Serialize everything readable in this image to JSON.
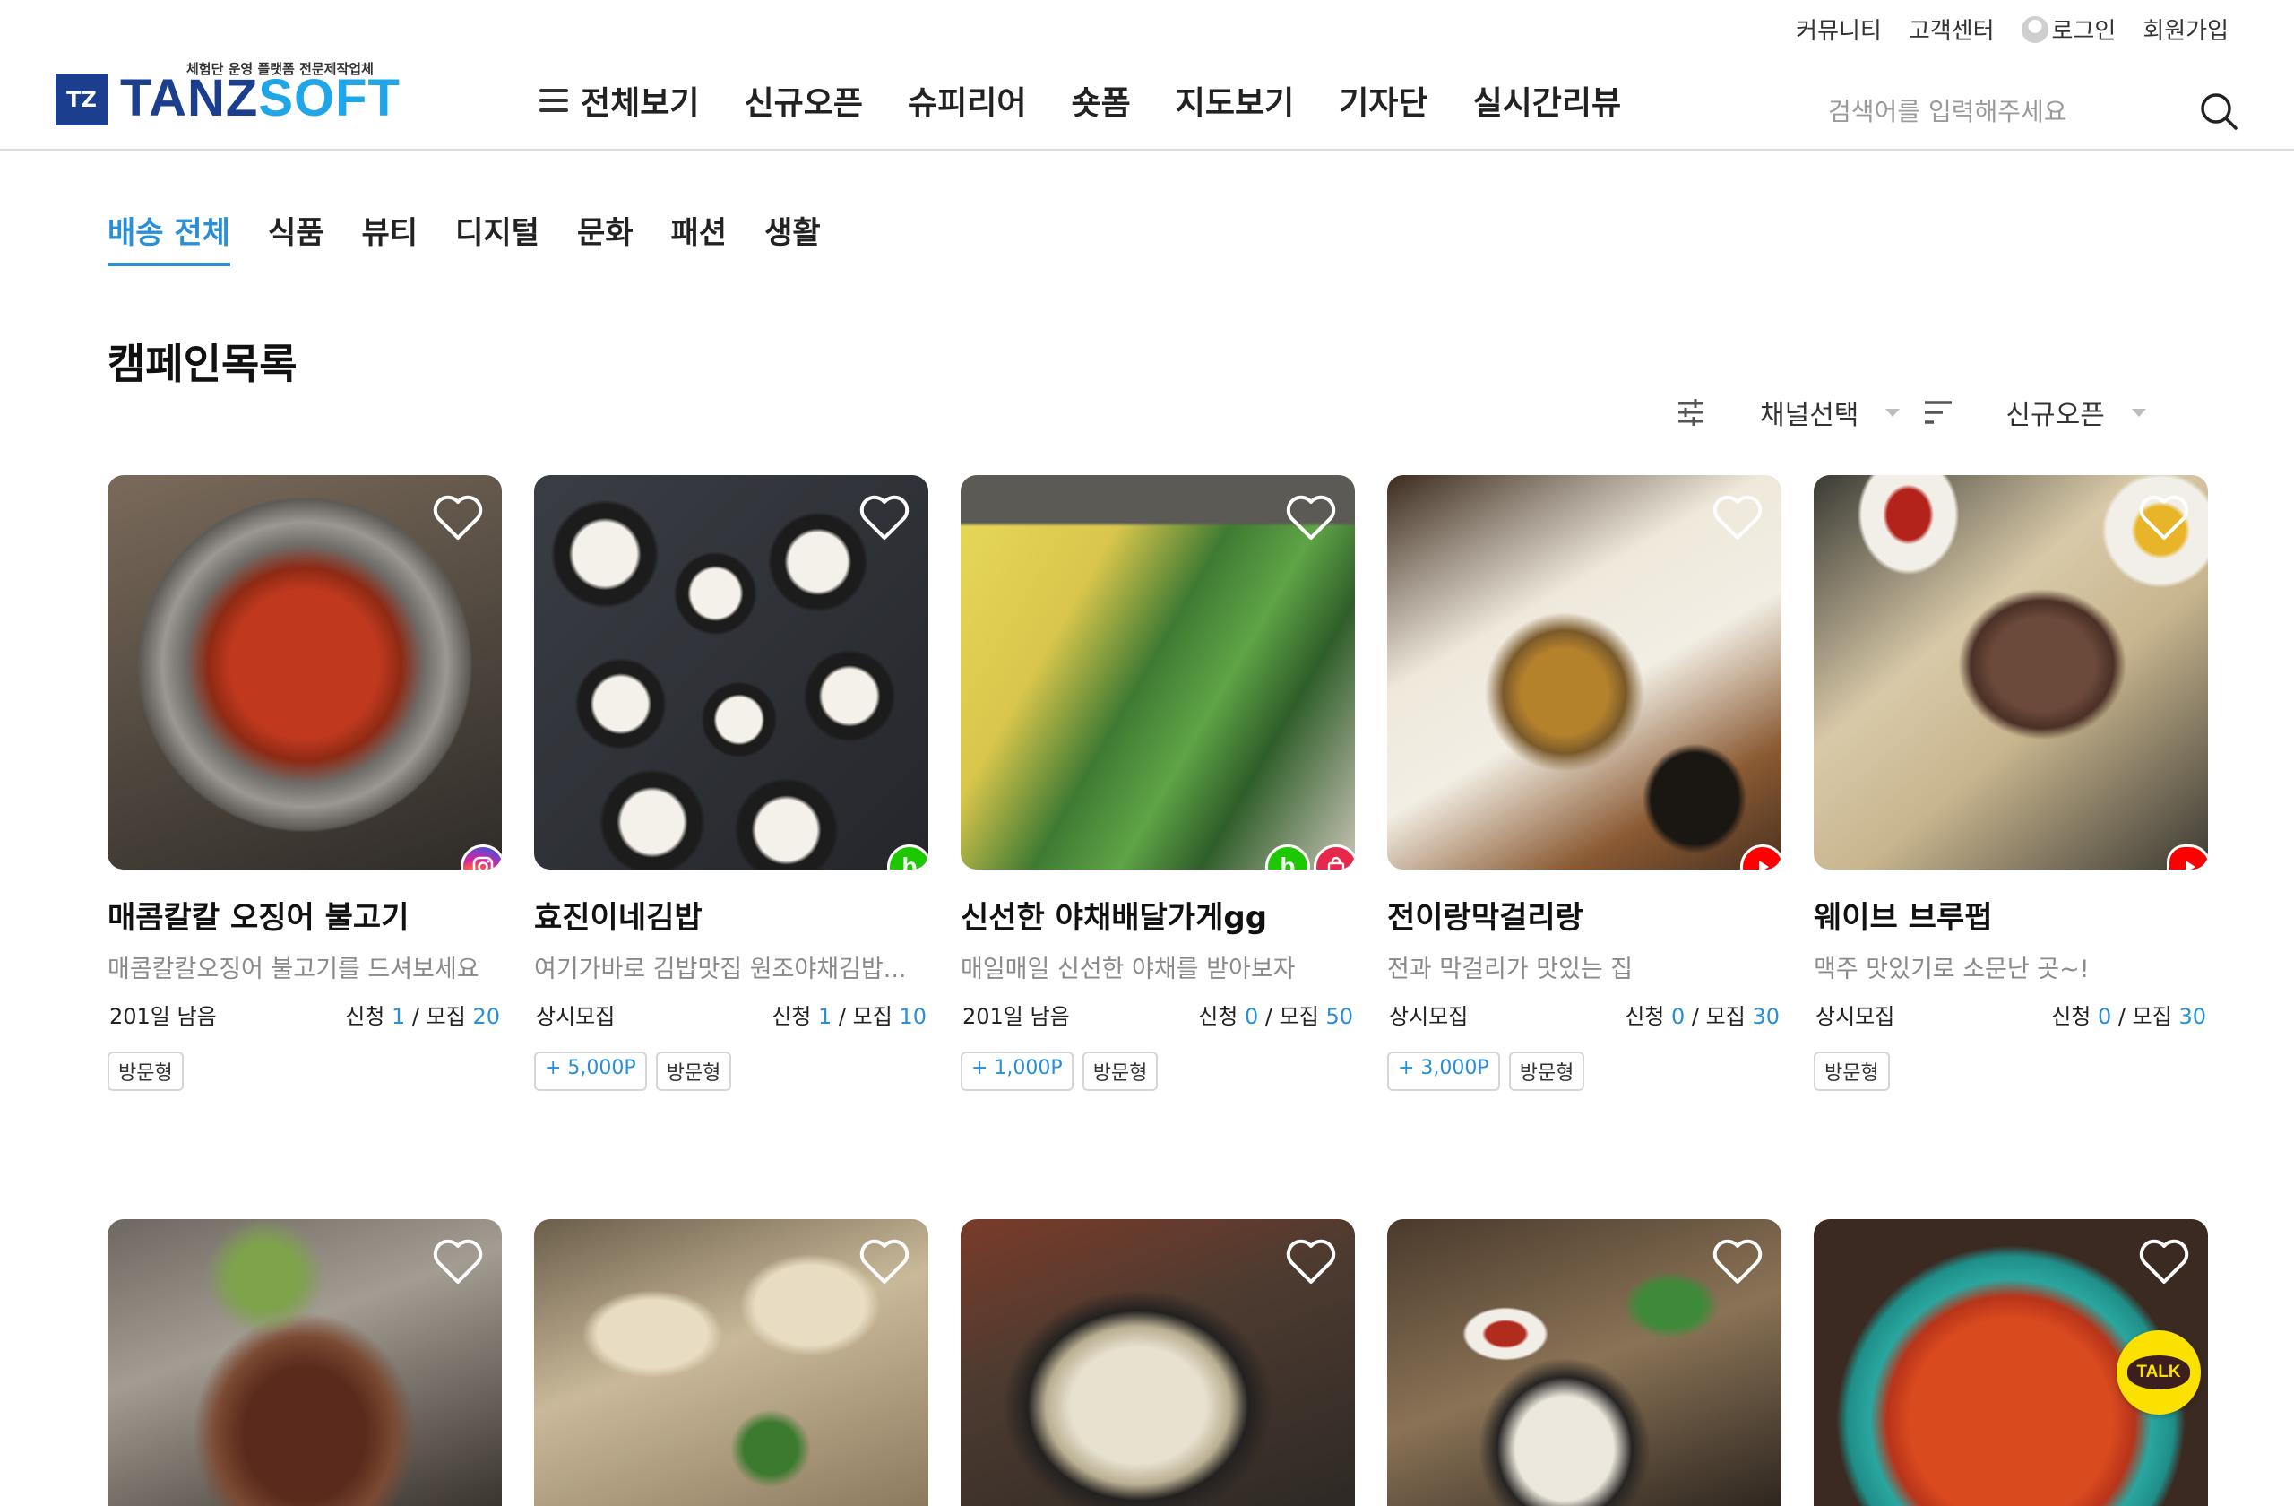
{
  "util_links": {
    "community": "커뮤니티",
    "customer_center": "고객센터",
    "login": "로그인",
    "signup": "회원가입"
  },
  "logo": {
    "tagline": "체험단 운영 플랫폼 전문제작업체",
    "mark": "TZ",
    "brand_main": "TANZ",
    "brand_accent": "SOFT"
  },
  "nav": {
    "items": [
      "전체보기",
      "신규오픈",
      "슈피리어",
      "숏폼",
      "지도보기",
      "기자단",
      "실시간리뷰"
    ]
  },
  "search": {
    "placeholder": "검색어를 입력해주세요"
  },
  "category_tabs": [
    "배송 전체",
    "식품",
    "뷰티",
    "디지털",
    "문화",
    "패션",
    "생활"
  ],
  "page_title": "캠페인목록",
  "filters": {
    "channel": "채널선택",
    "sort": "신규오픈"
  },
  "labels": {
    "apply": "신청",
    "recruit": "모집"
  },
  "campaigns": [
    {
      "name": "매콤칼칼 오징어 불고기",
      "desc": "매콤칼칼오징어 불고기를 드셔보세요",
      "status": "201일 남음",
      "applied": "1",
      "recruit": "20",
      "tags": [
        "방문형"
      ],
      "point": "",
      "channels": [
        "instagram"
      ]
    },
    {
      "name": "효진이네김밥",
      "desc": "여기가바로 김밥맛집 원조야채김밥...",
      "status": "상시모집",
      "applied": "1",
      "recruit": "10",
      "tags": [
        "방문형"
      ],
      "point": "+ 5,000P",
      "channels": [
        "blog"
      ]
    },
    {
      "name": "신선한 야채배달가게gg",
      "desc": "매일매일 신선한 야채를 받아보자",
      "status": "201일 남음",
      "applied": "0",
      "recruit": "50",
      "tags": [
        "방문형"
      ],
      "point": "+ 1,000P",
      "channels": [
        "blog",
        "shop"
      ]
    },
    {
      "name": "전이랑막걸리랑",
      "desc": "전과 막걸리가 맛있는 집",
      "status": "상시모집",
      "applied": "0",
      "recruit": "30",
      "tags": [
        "방문형"
      ],
      "point": "+ 3,000P",
      "channels": [
        "youtube"
      ]
    },
    {
      "name": "웨이브 브루펍",
      "desc": "맥주 맛있기로 소문난 곳~!",
      "status": "상시모집",
      "applied": "0",
      "recruit": "30",
      "tags": [
        "방문형"
      ],
      "point": "",
      "channels": [
        "shorts"
      ]
    }
  ],
  "kakao_talk": "TALK",
  "colors": {
    "accent": "#2a8fd6",
    "brand": "#1b3e8f",
    "brand_light": "#1ea6e8"
  }
}
